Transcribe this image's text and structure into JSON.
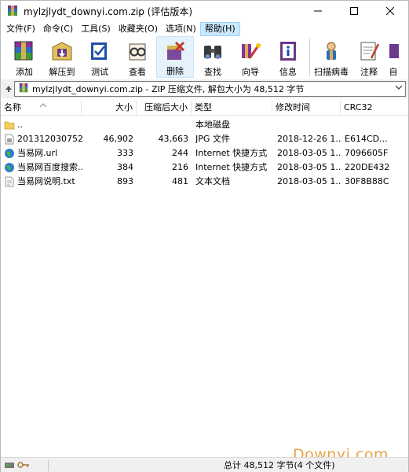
{
  "window": {
    "title": "mylzjlydt_downyi.com.zip (评估版本)",
    "controls": {
      "minimize": "—",
      "maximize": "☐",
      "close": "✕"
    }
  },
  "menu": [
    {
      "label": "文件(F)"
    },
    {
      "label": "命令(C)"
    },
    {
      "label": "工具(S)"
    },
    {
      "label": "收藏夹(O)"
    },
    {
      "label": "选项(N)"
    },
    {
      "label": "帮助(H)",
      "active": true
    }
  ],
  "toolbar": [
    {
      "label": "添加",
      "icon": "add-archive-icon"
    },
    {
      "label": "解压到",
      "icon": "extract-to-icon"
    },
    {
      "label": "测试",
      "icon": "test-icon"
    },
    {
      "label": "查看",
      "icon": "view-icon"
    },
    {
      "label": "删除",
      "icon": "delete-icon",
      "pressed": true
    },
    {
      "label": "查找",
      "icon": "find-icon"
    },
    {
      "label": "向导",
      "icon": "wizard-icon"
    },
    {
      "label": "信息",
      "icon": "info-icon"
    },
    {
      "label": "扫描病毒",
      "icon": "virus-scan-icon"
    },
    {
      "label": "注释",
      "icon": "comment-icon"
    },
    {
      "label": "自",
      "icon": "sfx-icon"
    }
  ],
  "pathbar": {
    "text": "mylzjlydt_downyi.com.zip - ZIP 压缩文件, 解包大小为 48,512 字节"
  },
  "columns": {
    "name": "名称",
    "size": "大小",
    "packed": "压缩后大小",
    "type": "类型",
    "modified": "修改时间",
    "crc": "CRC32"
  },
  "files": [
    {
      "name": "..",
      "size": "",
      "packed": "",
      "type": "本地磁盘",
      "modified": "",
      "crc": "",
      "icon": "folder-icon"
    },
    {
      "name": "201312030752...",
      "size": "46,902",
      "packed": "43,663",
      "type": "JPG 文件",
      "modified": "2018-12-26 1...",
      "crc": "E614CD...",
      "icon": "jpg-file-icon"
    },
    {
      "name": "当易网.url",
      "size": "333",
      "packed": "244",
      "type": "Internet 快捷方式",
      "modified": "2018-03-05 1...",
      "crc": "7096605F",
      "icon": "globe-icon"
    },
    {
      "name": "当易网百度搜索...",
      "size": "384",
      "packed": "216",
      "type": "Internet 快捷方式",
      "modified": "2018-03-05 1...",
      "crc": "220DE432",
      "icon": "globe-icon"
    },
    {
      "name": "当易网说明.txt",
      "size": "893",
      "packed": "481",
      "type": "文本文档",
      "modified": "2018-03-05 1...",
      "crc": "30F8B88C",
      "icon": "text-file-icon"
    }
  ],
  "status": {
    "text": "总计 48,512 字节(4 个文件)"
  },
  "watermark": "Downyi.com"
}
